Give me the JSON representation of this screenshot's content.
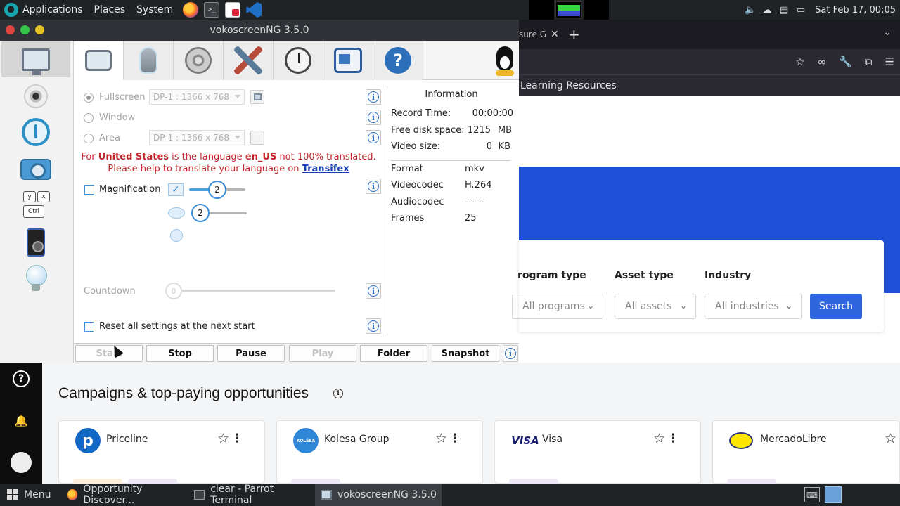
{
  "top_panel": {
    "menus": [
      "Applications",
      "Places",
      "System"
    ],
    "clock": "Sat Feb 17, 00:05"
  },
  "vokoscreen": {
    "title": "vokoscreenNG 3.5.0",
    "screen_options": [
      {
        "label": "Fullscreen",
        "selected": true,
        "display": "DP-1 :  1366 x 768"
      },
      {
        "label": "Window",
        "selected": false
      },
      {
        "label": "Area",
        "selected": false,
        "display": "DP-1 :  1366 x 768"
      }
    ],
    "translation_note": {
      "prefix": "For ",
      "country": "United States",
      "mid": " is the language ",
      "lang": "en_US",
      "suffix": " not 100% translated.",
      "line2": "Please help to translate your language on ",
      "link": "Transifex"
    },
    "magnification": {
      "label": "Magnification",
      "checked": false,
      "slider1_value": "2",
      "slider2_value": "2"
    },
    "countdown": {
      "label": "Countdown",
      "value": "0"
    },
    "reset": {
      "label": "Reset all settings at the next start",
      "checked": false
    },
    "information": {
      "title": "Information",
      "record_time_label": "Record Time:",
      "record_time": "00:00:00",
      "disk_label": "Free disk space:",
      "disk_value": "1215",
      "disk_unit": "MB",
      "video_size_label": "Video size:",
      "video_size_value": "0",
      "video_size_unit": "KB",
      "format_label": "Format",
      "format": "mkv",
      "videocodec_label": "Videocodec",
      "videocodec": "H.264",
      "audiocodec_label": "Audiocodec",
      "audiocodec": "------",
      "frames_label": "Frames",
      "frames": "25"
    },
    "buttons": {
      "start": "Start",
      "stop": "Stop",
      "pause": "Pause",
      "play": "Play",
      "folder": "Folder",
      "snapshot": "Snapshot"
    }
  },
  "browser": {
    "tab_fragment": "sure G",
    "bookmark": "Learning Resources",
    "filters": {
      "program_label": "rogram type",
      "program_value": "All programs",
      "asset_label": "Asset type",
      "asset_value": "All assets",
      "industry_label": "Industry",
      "industry_value": "All industries",
      "search": "Search"
    }
  },
  "page": {
    "section_title": "Campaigns & top-paying opportunities",
    "cards": [
      {
        "name": "Priceline",
        "logo_text": "p",
        "logo_color": "#1167c4"
      },
      {
        "name": "Kolesa Group",
        "logo_text": "KOLĖSA",
        "logo_color": "#2f86d6"
      },
      {
        "name": "Visa",
        "logo_text": "VISA",
        "logo_color": "#1a1f71"
      },
      {
        "name": "MercadoLibre",
        "logo_text": "",
        "logo_color": "#ffe600"
      }
    ]
  },
  "taskbar": {
    "menu": "Menu",
    "items": [
      "Opportunity Discover...",
      "clear - Parrot Terminal",
      "vokoscreenNG 3.5.0"
    ]
  },
  "colors": {
    "accent_blue": "#2d66dd",
    "hero_blue": "#1f4fd6",
    "warning_red": "#c0272d"
  }
}
